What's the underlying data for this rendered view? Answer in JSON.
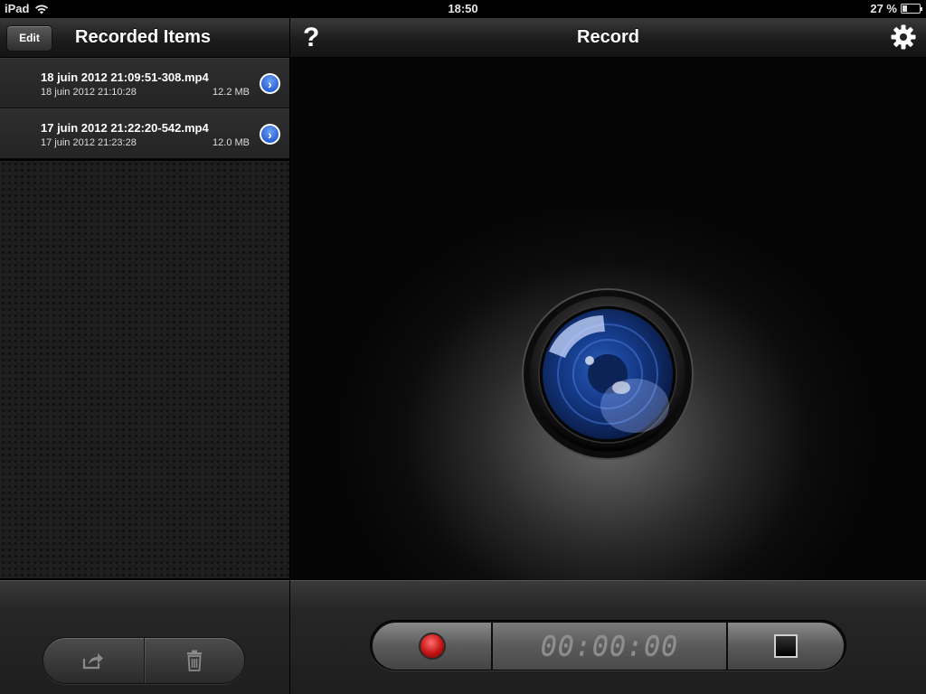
{
  "status_bar": {
    "carrier": "iPad",
    "time": "18:50",
    "battery_percent": "27 %",
    "battery_level": 0.27,
    "wifi_icon": "wifi-icon"
  },
  "left_pane": {
    "edit_label": "Edit",
    "title": "Recorded Items",
    "items": [
      {
        "name": "18 juin 2012 21:09:51-308.mp4",
        "date": "18 juin 2012 21:10:28",
        "size": "12.2 MB"
      },
      {
        "name": "17 juin 2012 21:22:20-542.mp4",
        "date": "17 juin 2012 21:23:28",
        "size": "12.0 MB"
      }
    ],
    "footer_actions": [
      "share-icon",
      "trash-icon"
    ]
  },
  "right_pane": {
    "help_label": "?",
    "title": "Record",
    "gear_icon": "gear-icon",
    "timer": "00:00:00"
  }
}
